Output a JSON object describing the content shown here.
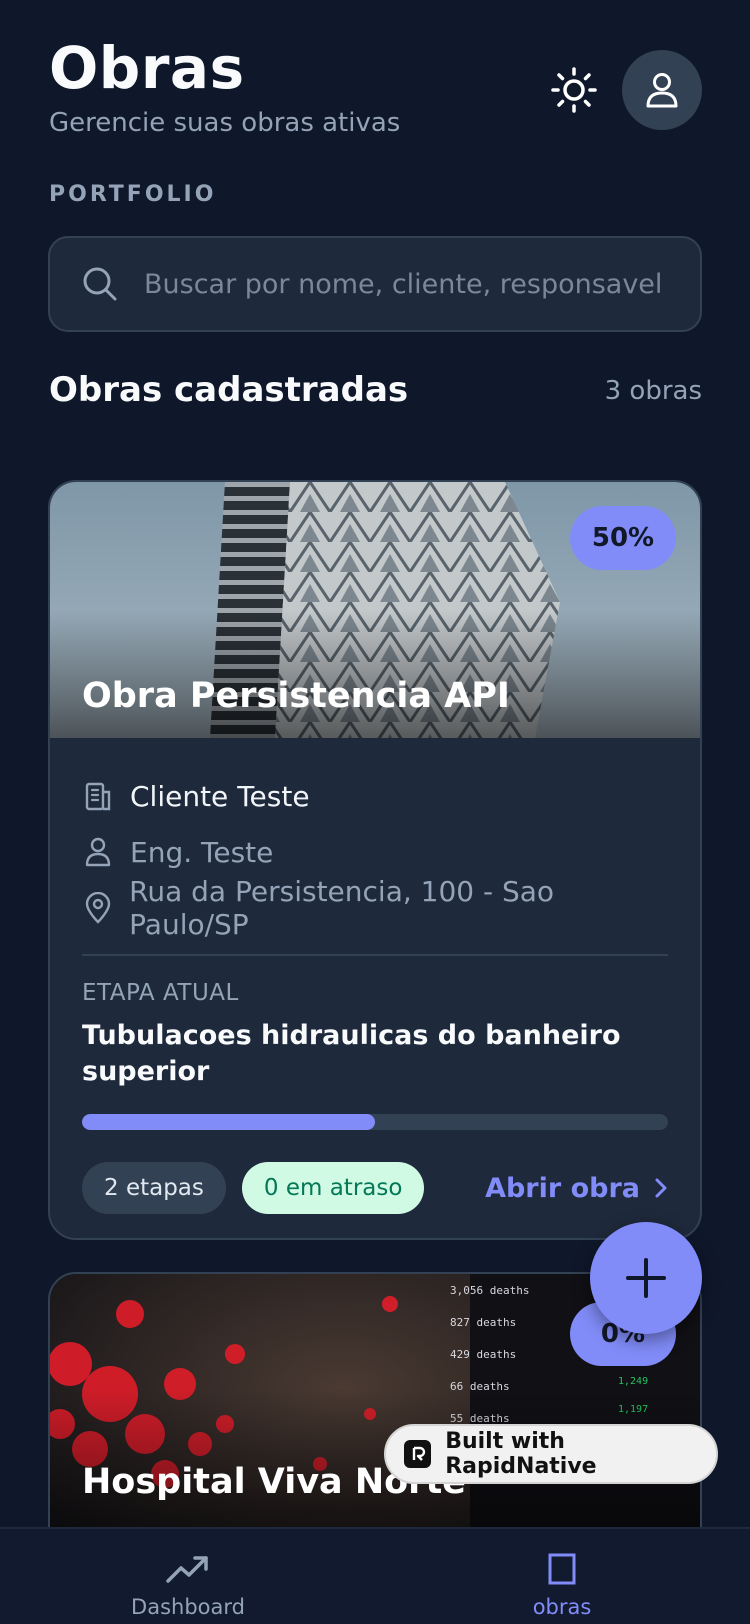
{
  "header": {
    "title": "Obras",
    "subtitle": "Gerencie suas obras ativas"
  },
  "section_label": "PORTFOLIO",
  "search": {
    "placeholder": "Buscar por nome, cliente, responsavel, endereco",
    "value": ""
  },
  "list": {
    "title": "Obras cadastradas",
    "count": "3 obras"
  },
  "cards": [
    {
      "name": "Obra Persistencia API",
      "progress_label": "50%",
      "progress": 0.5,
      "client": "Cliente Teste",
      "engineer": "Eng. Teste",
      "address": "Rua da Persistencia, 100 - Sao Paulo/SP",
      "stage_label": "ETAPA ATUAL",
      "stage_name": "Tubulacoes hidraulicas do banheiro superior",
      "chip_steps": "2 etapas",
      "chip_delay": "0 em atraso",
      "open_label": "Abrir obra"
    },
    {
      "name": "Hospital Viva Norte",
      "progress_label": "0%"
    }
  ],
  "built_badge": "Built with RapidNative",
  "tabs": [
    {
      "label": "Dashboard",
      "icon": "trending-up-icon"
    },
    {
      "label": "obras",
      "icon": "building-icon"
    }
  ],
  "colors": {
    "background": "#0f172a",
    "card": "#1e293b",
    "accent": "#818cf8",
    "success_bg": "#d1fae5",
    "success_text": "#047857"
  }
}
